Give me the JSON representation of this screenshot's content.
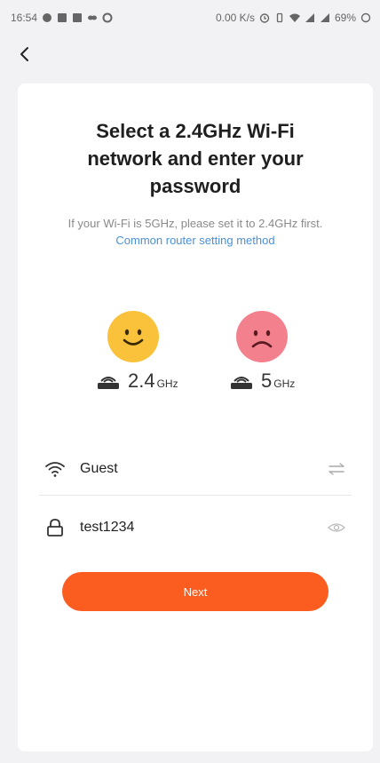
{
  "status_bar": {
    "time": "16:54",
    "speed": "0.00 K/s",
    "battery": "69%",
    "icons": [
      "app-icon",
      "notification-icon",
      "notification-icon",
      "link-icon",
      "sync-icon",
      "alarm-icon",
      "vibrate-icon",
      "wifi-icon",
      "signal-icon",
      "signal-icon",
      "battery-icon"
    ]
  },
  "nav": {
    "back_icon": "chevron-left-icon"
  },
  "title_lines": [
    "Select a 2.4GHz Wi-Fi",
    "network and enter your",
    "password"
  ],
  "hint": {
    "text": "If your Wi-Fi is 5GHz, please set it to 2.4GHz first.",
    "link": "Common router setting method"
  },
  "bands": {
    "supported": {
      "icon": "smile-face-icon",
      "value": "2.4",
      "unit": "GHz"
    },
    "unsupported": {
      "icon": "sad-face-icon",
      "value": "5",
      "unit": "GHz"
    }
  },
  "form": {
    "ssid_value": "Guest",
    "password_value": "test1234"
  },
  "next_label": "Next",
  "colors": {
    "accent": "#fb5d20",
    "link": "#4a90d9",
    "happy": "#f9c23a",
    "sad": "#f3818d"
  }
}
